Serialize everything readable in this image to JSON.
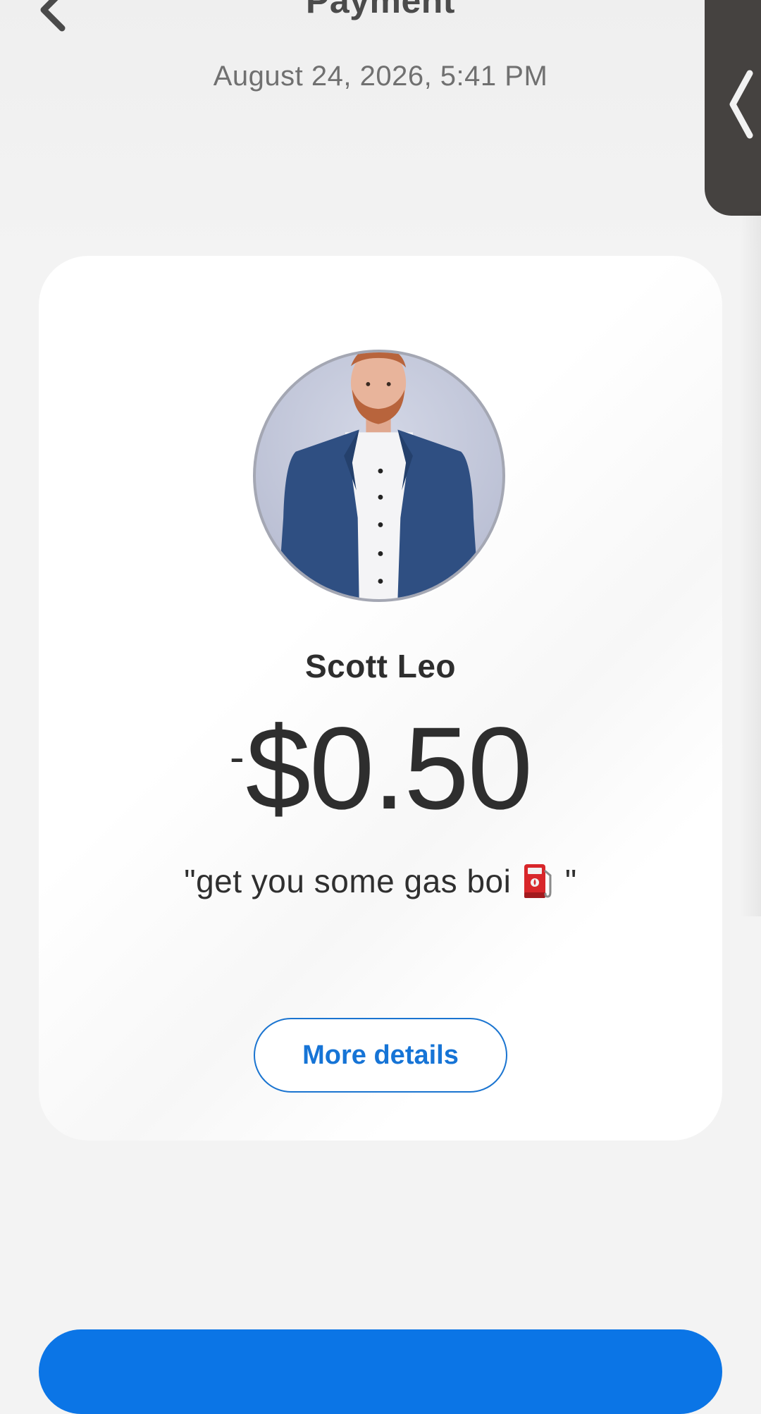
{
  "header": {
    "title": "Payment",
    "datetime": "August 24, 2026, 5:41 PM",
    "back_icon": "chevron-left-icon",
    "side_tab_icon": "chevron-left-icon"
  },
  "payment": {
    "recipient_name": "Scott Leo",
    "amount_sign": "-",
    "amount_value": "$0.50",
    "memo_prefix": "\"get you some gas boi",
    "memo_emoji": "fuel-pump-icon",
    "memo_suffix": "\""
  },
  "actions": {
    "more_details_label": "More details"
  },
  "colors": {
    "accent": "#1674d6",
    "primary_button": "#0b75e6",
    "side_tab": "#454240",
    "background": "#f3f3f3",
    "card": "#ffffff"
  }
}
